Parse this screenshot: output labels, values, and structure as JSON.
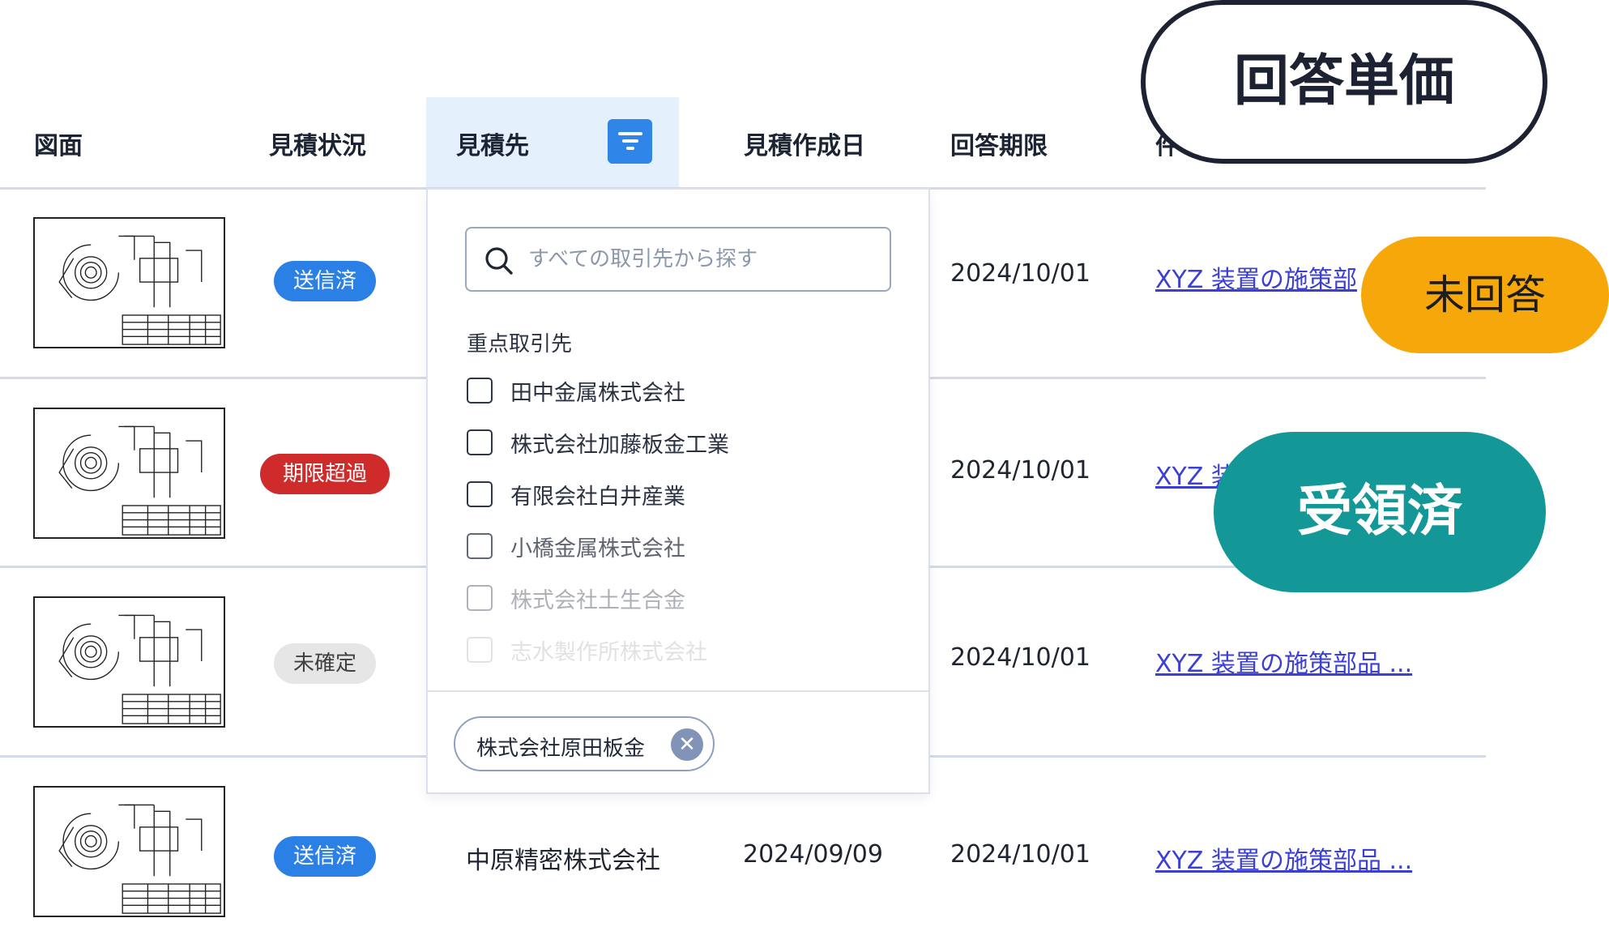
{
  "columns": {
    "drawing": "図面",
    "status": "見積状況",
    "supplier": "見積先",
    "created": "見積作成日",
    "deadline": "回答期限",
    "subject_partial": "件"
  },
  "rows": [
    {
      "status": "送信済",
      "status_color": "#2b80e6",
      "supplier": "",
      "created": "",
      "deadline": "2024/10/01",
      "subject": "XYZ 装置の施策部品 ..."
    },
    {
      "status": "期限超過",
      "status_color": "#d02b2b",
      "supplier": "",
      "created": "",
      "deadline": "2024/10/01",
      "subject": "XYZ 装置の施策部品 ..."
    },
    {
      "status": "未確定",
      "status_color": "#e6e6e6",
      "supplier": "",
      "created": "",
      "deadline": "2024/10/01",
      "subject": "XYZ 装置の施策部品 ..."
    },
    {
      "status": "送信済",
      "status_color": "#2b80e6",
      "supplier": "中原精密株式会社",
      "created": "2024/09/09",
      "deadline": "2024/10/01",
      "subject": "XYZ 装置の施策部品 ..."
    }
  ],
  "visible_subjects": {
    "row1": "XYZ 装置の施策部",
    "row2": "XYZ 装",
    "row3": "XYZ 装置の施策部品 ...",
    "row4": "XYZ 装置の施策部品 ..."
  },
  "dropdown": {
    "search_placeholder": "すべての取引先から探す",
    "section_label": "重点取引先",
    "options": [
      {
        "label": "田中金属株式会社",
        "checked": false
      },
      {
        "label": "株式会社加藤板金工業",
        "checked": false
      },
      {
        "label": "有限会社白井産業",
        "checked": false
      },
      {
        "label": "小橋金属株式会社",
        "checked": false
      },
      {
        "label": "株式会社土生合金",
        "checked": false
      },
      {
        "label": "志水製作所株式会社",
        "checked": false
      }
    ],
    "selected_chip": "株式会社原田板金"
  },
  "callouts": {
    "price": "回答単価",
    "unanswered": "未回答",
    "received": "受領済"
  },
  "colors": {
    "accent": "#2f86e8",
    "header_highlight": "#e4f0fb",
    "link": "#3b3fd6",
    "unanswered": "#f6a80b",
    "received": "#139797"
  }
}
